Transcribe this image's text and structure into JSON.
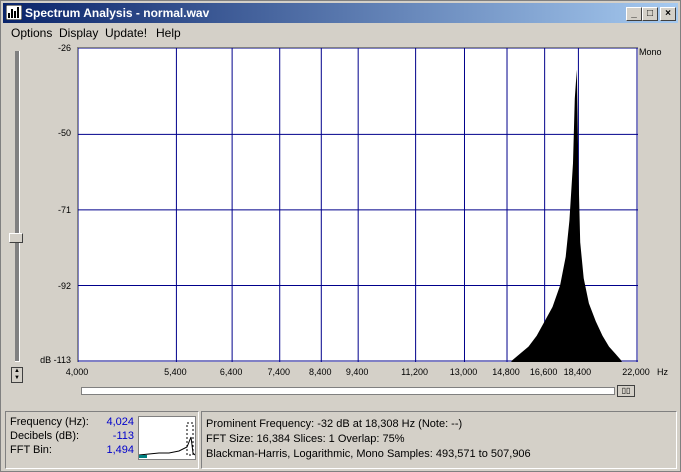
{
  "window": {
    "title": "Spectrum Analysis - normal.wav"
  },
  "menu": {
    "items": [
      "Options",
      "Display",
      "Update!",
      "Help"
    ]
  },
  "chart_data": {
    "type": "area",
    "ylabel": "dB",
    "xlabel": "Hz",
    "channel_label": "Mono",
    "x_scale": "log",
    "xlim": [
      4000,
      22000
    ],
    "ylim": [
      -113,
      -26
    ],
    "y_tick_labels": [
      "-26",
      "-50",
      "-71",
      "-92",
      "dB -113"
    ],
    "y_ticks": [
      -26,
      -50,
      -71,
      -92,
      -113
    ],
    "x_tick_labels": [
      "4,000",
      "5,400",
      "6,400",
      "7,400",
      "8,400",
      "9,400",
      "11,200",
      "13,000",
      "14,800",
      "16,600",
      "18,400",
      "22,000"
    ],
    "x_ticks": [
      4000,
      5400,
      6400,
      7400,
      8400,
      9400,
      11200,
      13000,
      14800,
      16600,
      18400,
      22000
    ],
    "grid": true,
    "line_color": "#00008b",
    "fill_color": "#000000",
    "series": [
      {
        "x": [
          15000,
          15400,
          15800,
          16200,
          16600,
          17000,
          17400,
          17700,
          17900,
          18100,
          18200,
          18308,
          18400,
          18500,
          18700,
          19000,
          19400,
          19800,
          20200,
          20600,
          21000
        ],
        "y": [
          -113,
          -111,
          -109,
          -106,
          -102,
          -98,
          -92,
          -84,
          -74,
          -58,
          -40,
          -32,
          -60,
          -80,
          -90,
          -97,
          -102,
          -106,
          -109,
          -111,
          -113
        ]
      }
    ]
  },
  "status": {
    "frequency_label": "Frequency (Hz):",
    "frequency_value": "4,024",
    "decibels_label": "Decibels (dB):",
    "decibels_value": "-113",
    "fft_bin_label": "FFT Bin:",
    "fft_bin_value": "1,494",
    "line1": "Prominent Frequency: -32 dB at 18,308 Hz (Note: --)",
    "line2": "FFT Size: 16,384  Slices: 1  Overlap: 75%",
    "line3": "Blackman-Harris, Logarithmic, Mono  Samples: 493,571 to 507,906"
  },
  "colors": {
    "title_start": "#0a246a",
    "title_end": "#a6caf0",
    "value_blue": "#0000cc"
  }
}
